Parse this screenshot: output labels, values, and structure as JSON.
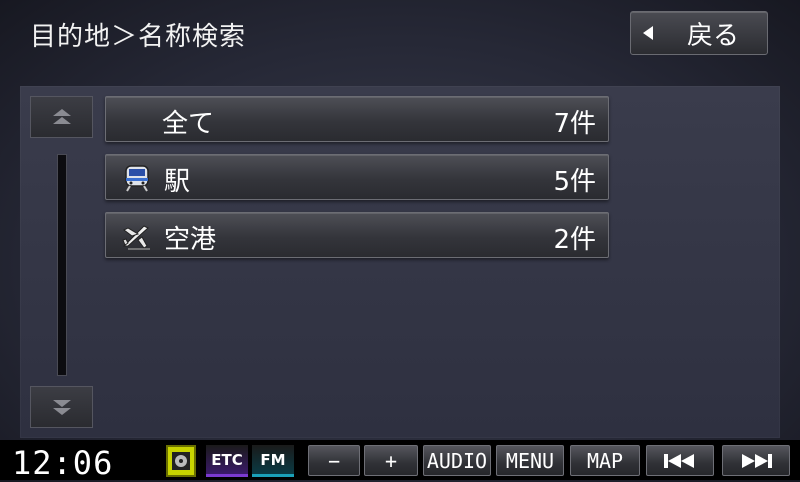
{
  "header": {
    "title": "目的地＞名称検索",
    "back_label": "戻る"
  },
  "categories": [
    {
      "icon": "all",
      "label": "全て",
      "count": "7件"
    },
    {
      "icon": "train-icon",
      "label": "駅",
      "count": "5件"
    },
    {
      "icon": "airplane-icon",
      "label": "空港",
      "count": "2件"
    }
  ],
  "bottom_bar": {
    "clock": "12:06",
    "etc": "ETC",
    "fm": "FM",
    "minus": "−",
    "plus": "+",
    "audio": "AUDIO",
    "menu": "MENU",
    "map": "MAP"
  }
}
